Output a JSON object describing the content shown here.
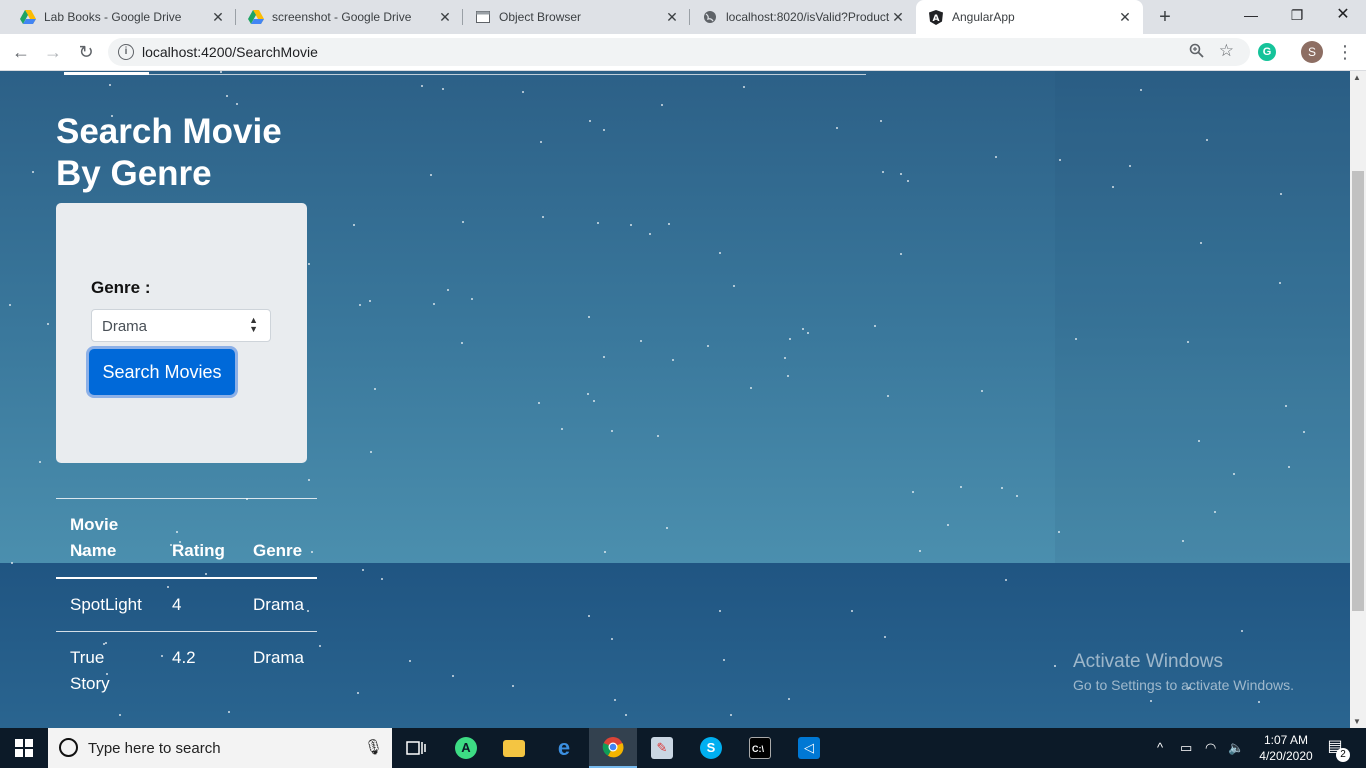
{
  "browser": {
    "tabs": [
      {
        "title": "Lab Books - Google Drive",
        "icon": "google-drive-icon"
      },
      {
        "title": "screenshot - Google Drive",
        "icon": "google-drive-icon"
      },
      {
        "title": "Object Browser",
        "icon": "page-icon"
      },
      {
        "title": "localhost:8020/isValid?Product",
        "icon": "globe-icon"
      },
      {
        "title": "AngularApp",
        "icon": "angular-icon",
        "active": true
      }
    ],
    "new_tab": "+",
    "url": "localhost:4200/SearchMovie",
    "profile_initial": "S",
    "extension_initial": "G"
  },
  "page": {
    "title": "Search Movie By Genre",
    "genre_label": "Genre :",
    "genre_selected": "Drama",
    "search_button": "Search Movies",
    "table": {
      "headers": [
        "Movie Name",
        "Rating",
        "Genre"
      ],
      "rows": [
        [
          "SpotLight",
          "4",
          "Drama"
        ],
        [
          "True Story",
          "4.2",
          "Drama"
        ]
      ]
    }
  },
  "watermark": {
    "line1": "Activate Windows",
    "line2": "Go to Settings to activate Windows."
  },
  "taskbar": {
    "search_placeholder": "Type here to search",
    "time": "1:07 AM",
    "date": "4/20/2020",
    "notification_count": "2"
  },
  "colors": {
    "primary_button": "#0069d9",
    "page_background": "#3a789c",
    "card_background": "#e9ecef"
  }
}
